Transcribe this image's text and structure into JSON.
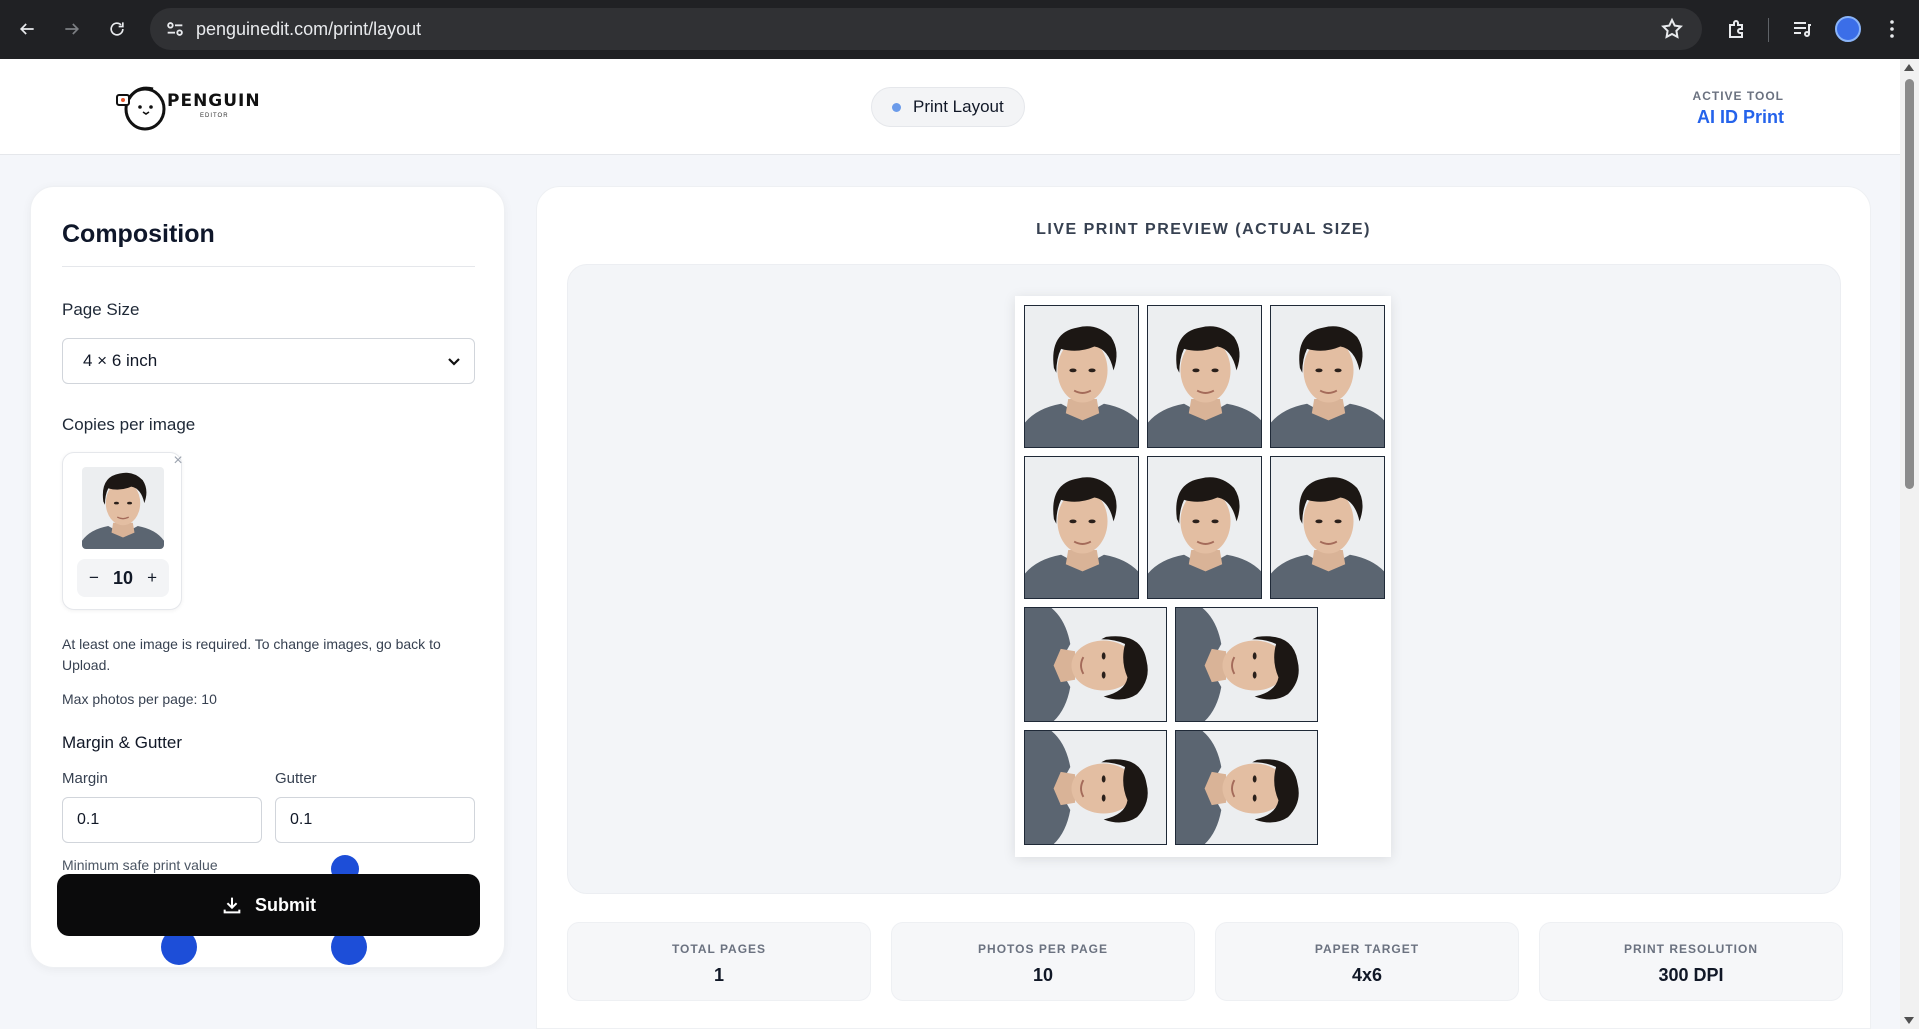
{
  "browser": {
    "url": "penguinedit.com/print/layout"
  },
  "header": {
    "logo_text": "PENGUIN",
    "logo_sub": "EDITOR",
    "step_pill": "Print Layout",
    "active_tool_label": "ACTIVE TOOL",
    "active_tool_value": "AI ID Print"
  },
  "composition": {
    "title": "Composition",
    "page_size_label": "Page Size",
    "page_size_value": "4 × 6 inch",
    "copies_label": "Copies per image",
    "copies_count": "10",
    "decrement": "−",
    "increment": "+",
    "remove_glyph": "×",
    "helper_required": "At least one image is required. To change images, go back to Upload.",
    "max_photos": "Max photos per page: 10",
    "margin_gutter_title": "Margin & Gutter",
    "margin_label": "Margin",
    "margin_value": "0.1",
    "gutter_label": "Gutter",
    "gutter_value": "0.1",
    "min_safe": "Minimum safe print value",
    "submit_label": "Submit"
  },
  "preview": {
    "title": "LIVE PRINT PREVIEW (ACTUAL SIZE)",
    "photos_upright": 6,
    "photos_rotated": 4
  },
  "stats": [
    {
      "label": "TOTAL PAGES",
      "value": "1"
    },
    {
      "label": "PHOTOS PER PAGE",
      "value": "10"
    },
    {
      "label": "PAPER TARGET",
      "value": "4x6"
    },
    {
      "label": "PRINT RESOLUTION",
      "value": "300 DPI"
    }
  ]
}
